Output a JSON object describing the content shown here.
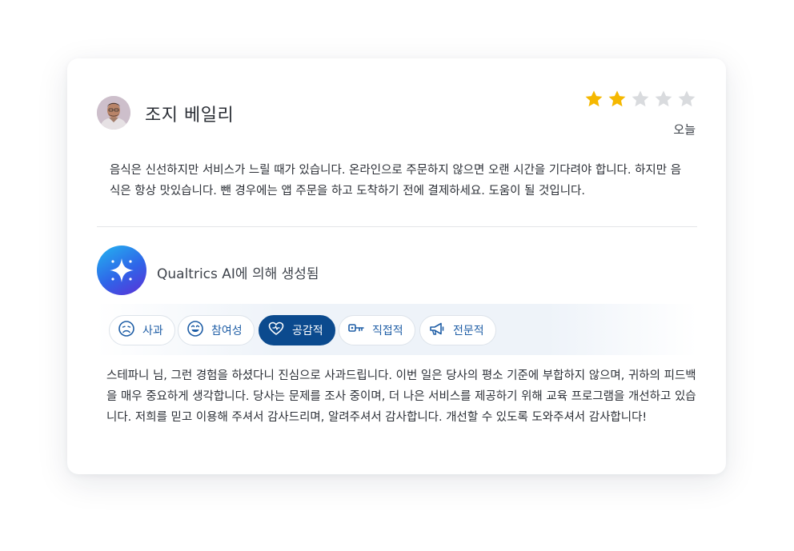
{
  "review": {
    "reviewer_name": "조지 베일리",
    "rating": 2,
    "max_rating": 5,
    "date": "오늘",
    "text": "음식은 신선하지만 서비스가 느릴 때가 있습니다. 온라인으로 주문하지 않으면 오랜 시간을 기다려야 합니다. 하지만 음식은 항상 맛있습니다. 뺀 경우에는 앱 주문을 하고 도착하기 전에 결제하세요. 도움이 될 것입니다."
  },
  "ai": {
    "label": "Qualtrics AI에 의해 생성됨",
    "tones": [
      {
        "label": "사과",
        "icon": "sad-face-icon",
        "active": false
      },
      {
        "label": "참여성",
        "icon": "laughing-face-icon",
        "active": false
      },
      {
        "label": "공감적",
        "icon": "heart-icon",
        "active": true
      },
      {
        "label": "직접적",
        "icon": "key-icon",
        "active": false
      },
      {
        "label": "전문적",
        "icon": "megaphone-icon",
        "active": false
      }
    ],
    "response": "스테파니 님, 그런 경험을 하셨다니 진심으로 사과드립니다. 이번 일은 당사의 평소 기준에 부합하지 않으며, 귀하의 피드백을 매우 중요하게 생각합니다. 당사는 문제를 조사 중이며, 더 나은 서비스를 제공하기 위해 교육 프로그램을 개선하고 있습니다. 저희를 믿고 이용해 주셔서 감사드리며, 알려주셔서 감사합니다. 개선할 수 있도록 도와주셔서 감사합니다!"
  },
  "colors": {
    "star_filled": "#f5b800",
    "star_empty": "#d9dbde",
    "active_chip": "#0b4a8e",
    "chip_text": "#1f5ea6"
  }
}
